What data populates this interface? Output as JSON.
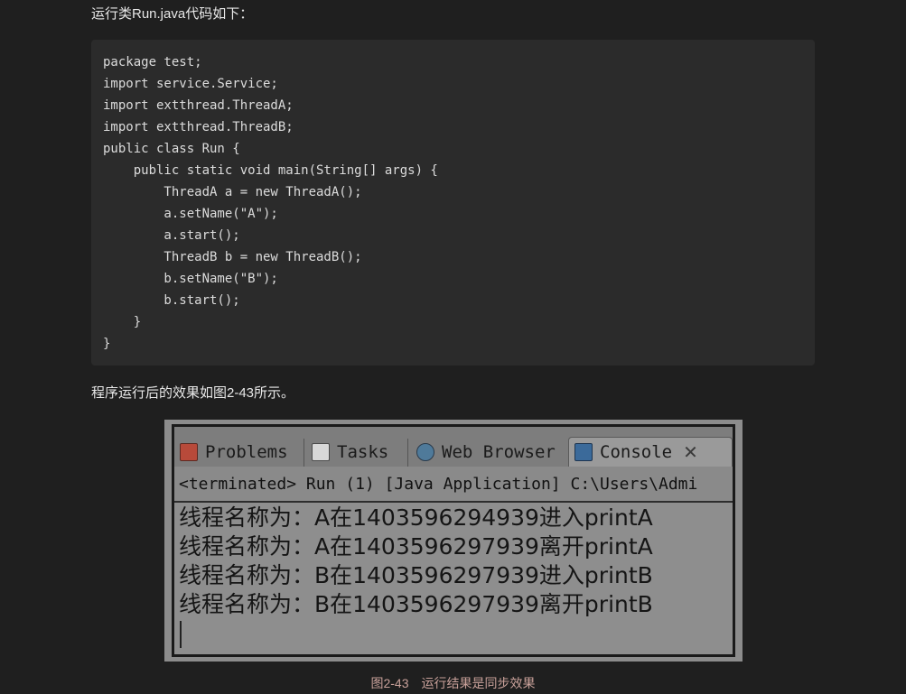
{
  "article": {
    "intro_text": "运行类Run.java代码如下：",
    "after_text": "程序运行后的效果如图2-43所示。",
    "caption": "图2-43　运行结果是同步效果"
  },
  "code": {
    "lines": [
      "package test;",
      "import service.Service;",
      "import extthread.ThreadA;",
      "import extthread.ThreadB;",
      "public class Run {",
      "    public static void main(String[] args) {",
      "        ThreadA a = new ThreadA();",
      "        a.setName(\"A\");",
      "        a.start();",
      "        ThreadB b = new ThreadB();",
      "        b.setName(\"B\");",
      "        b.start();",
      "    }",
      "}"
    ]
  },
  "figure": {
    "tabs": [
      {
        "label": "Problems",
        "icon": "problems-icon"
      },
      {
        "label": "Tasks",
        "icon": "tasks-icon"
      },
      {
        "label": "Web Browser",
        "icon": "globe-icon"
      },
      {
        "label": "Console",
        "icon": "console-icon"
      }
    ],
    "close_glyph": "✕",
    "status": "<terminated> Run (1) [Java Application] C:\\Users\\Admi",
    "output": [
      "线程名称为：A在1403596294939进入printA",
      "线程名称为：A在1403596297939离开printA",
      "线程名称为：B在1403596297939进入printB",
      "线程名称为：B在1403596297939离开printB"
    ]
  },
  "colors": {
    "page_background": "#1f1f1f",
    "code_background": "#2b2b2b",
    "caption": "#c9a19a"
  }
}
